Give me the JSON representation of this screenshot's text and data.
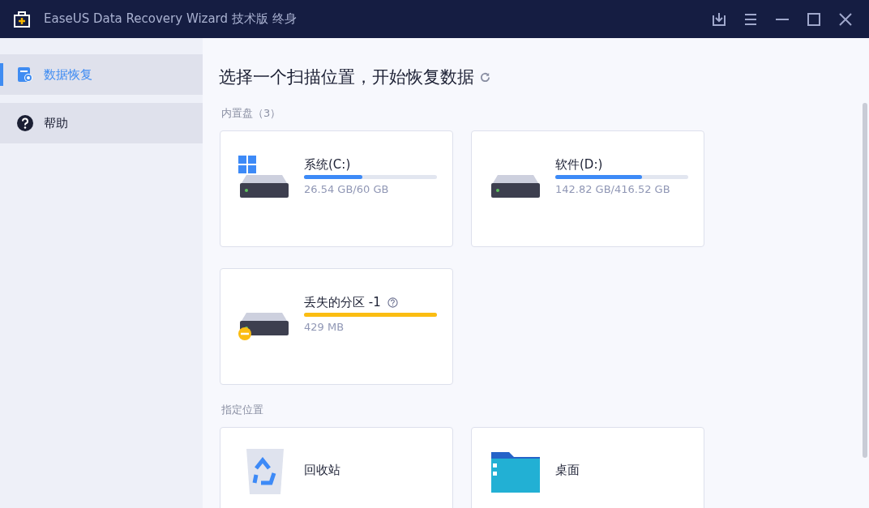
{
  "window": {
    "title": "EaseUS Data Recovery Wizard 技术版 终身"
  },
  "sidebar": {
    "items": [
      {
        "label": "数据恢复",
        "kind": "recover",
        "selected": true
      },
      {
        "label": "帮助",
        "kind": "help",
        "selected": false
      }
    ]
  },
  "heading": "选择一个扫描位置，开始恢复数据",
  "sections": [
    {
      "label": "内置盘（3）",
      "cards": [
        {
          "kind": "system",
          "name": "系统(C:)",
          "size": "26.54 GB/60 GB",
          "level": 0.44,
          "color": "#3d8af7"
        },
        {
          "kind": "drive",
          "name": "软件(D:)",
          "size": "142.82 GB/416.52 GB",
          "level": 0.65,
          "color": "#3d8af7"
        },
        {
          "kind": "lost",
          "name": "丢失的分区 -1",
          "size": "429 MB",
          "level": 1,
          "color": "#fbbd12"
        }
      ]
    },
    {
      "label": "指定位置",
      "cards": [
        {
          "kind": "recycle-bin",
          "name": "回收站"
        },
        {
          "kind": "folder",
          "name": "桌面"
        }
      ]
    }
  ]
}
